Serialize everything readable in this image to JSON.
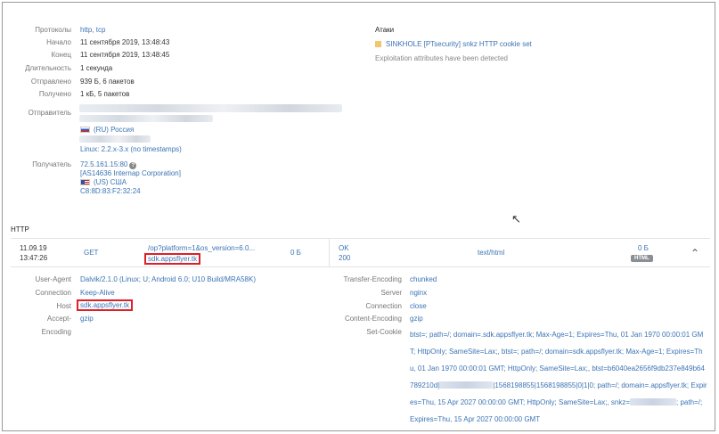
{
  "summary": {
    "protocols_label": "Протоколы",
    "protocols_value": "http, tcp",
    "start_label": "Начало",
    "start_value": "11 сентября 2019, 13:48:43",
    "end_label": "Конец",
    "end_value": "11 сентября 2019, 13:48:45",
    "duration_label": "Длительность",
    "duration_value": "1 секунда",
    "sent_label": "Отправлено",
    "sent_value": "939 Б, 6 пакетов",
    "received_label": "Получено",
    "received_value": "1 кБ, 5 пакетов",
    "sender_label": "Отправитель",
    "sender_country": "(RU)  Россия",
    "sender_os": "Linux: 2.2.x-3.x (no timestamps)",
    "receiver_label": "Получатель",
    "receiver_ip": "72.5.161.15:80",
    "receiver_as": "[AS14636 Internap Corporation]",
    "receiver_country": "(US)  США",
    "receiver_mac": "C8:8D:83:F2:32:24"
  },
  "attacks": {
    "title": "Атаки",
    "item": "SINKHOLE [PTsecurity] snkz HTTP cookie set",
    "note": "Exploitation attributes have been detected"
  },
  "http": {
    "section_title": "HTTP",
    "row": {
      "date": "11.09.19",
      "time": "13:47:26",
      "method": "GET",
      "path": "/op?platform=1&os_version=6.0...",
      "host": "sdk.appsflyer.tk",
      "req_size": "0 Б",
      "status_text": "OK",
      "status_code": "200",
      "content_type": "text/html",
      "resp_size": "0 Б",
      "badge": "HTML"
    },
    "request_headers": {
      "user_agent_label": "User-Agent",
      "user_agent_value": "Dalvik/2.1.0 (Linux; U; Android 6.0; U10 Build/MRA58K)",
      "connection_label": "Connection",
      "connection_value": "Keep-Alive",
      "host_label": "Host",
      "host_value": "sdk.appsflyer.tk",
      "accept_encoding_label_1": "Accept-",
      "accept_encoding_label_2": "Encoding",
      "accept_encoding_value": "gzip"
    },
    "response_headers": {
      "transfer_encoding_label": "Transfer-Encoding",
      "transfer_encoding_value": "chunked",
      "server_label": "Server",
      "server_value": "nginx",
      "connection_label": "Connection",
      "connection_value": "close",
      "content_encoding_label": "Content-Encoding",
      "content_encoding_value": "gzip",
      "set_cookie_label": "Set-Cookie",
      "set_cookie_part1": "btst=; path=/; domain=.sdk.appsflyer.tk; Max-Age=1; Expires=Thu, 01 Jan 1970 00:00:01 GMT; HttpOnly; SameSite=Lax;, btst=; path=/; domain=sdk.appsflyer.tk; Max-Age=1; Expires=Thu, 01 Jan 1970 00:00:01 GMT; HttpOnly; SameSite=Lax;, btst=b6040ea2656f9db237e849b64789210d|",
      "set_cookie_part2": "|1568198855|1568198855|0|1|0; path=/; domain=.appsflyer.tk; Expires=Thu, 15 Apr 2027 00:00:00 GMT; HttpOnly; SameSite=Lax;, snkz=",
      "set_cookie_part3": "; path=/; Expires=Thu, 15 Apr 2027 00:00:00 GMT"
    }
  },
  "icons": {
    "help": "?",
    "collapse": "⌃",
    "cursor": "↖"
  }
}
